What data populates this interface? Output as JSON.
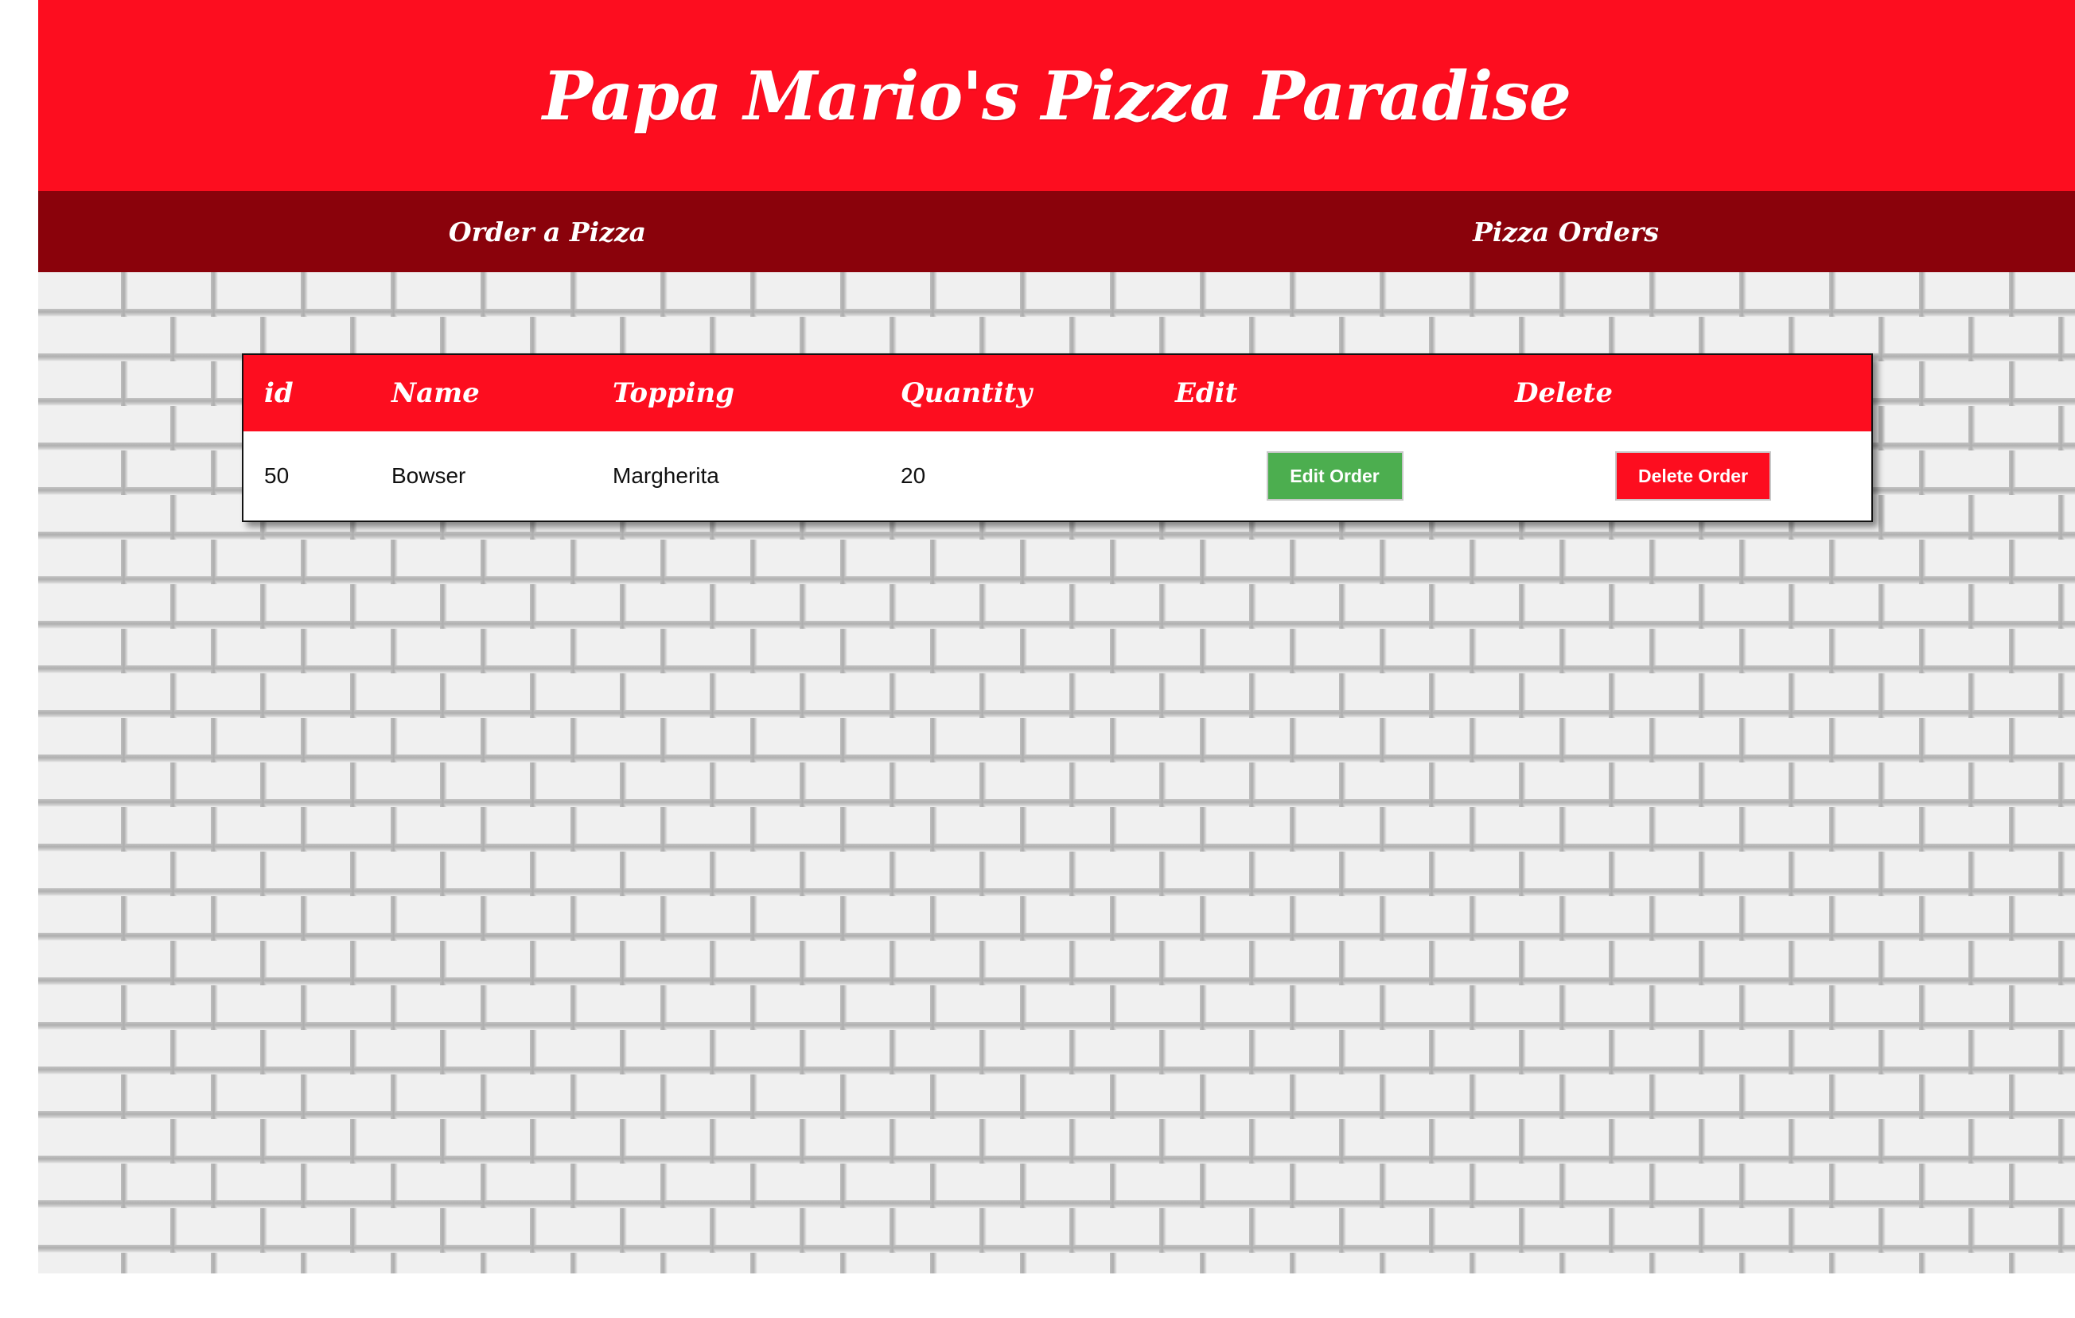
{
  "header": {
    "title": "Papa Mario's Pizza Paradise"
  },
  "nav": {
    "items": [
      {
        "label": "Order a Pizza"
      },
      {
        "label": "Pizza Orders"
      }
    ]
  },
  "orders_table": {
    "columns": [
      "id",
      "Name",
      "Topping",
      "Quantity",
      "Edit",
      "Delete"
    ],
    "rows": [
      {
        "id": "50",
        "name": "Bowser",
        "topping": "Margherita",
        "quantity": "20",
        "edit_label": "Edit Order",
        "delete_label": "Delete Order"
      }
    ]
  },
  "colors": {
    "brand_red": "#fd0d1f",
    "nav_dark_red": "#8a020b",
    "edit_green": "#4cae4f",
    "brick_gray": "#f0f0f0"
  }
}
